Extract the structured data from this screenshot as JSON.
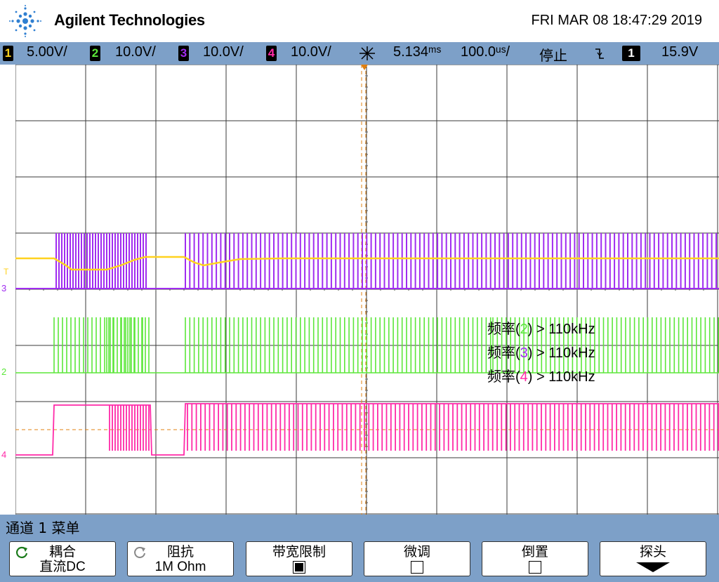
{
  "header": {
    "brand": "Agilent Technologies",
    "datetime": "FRI MAR 08 18:47:29 2019"
  },
  "status": {
    "ch1": {
      "num": "1",
      "scale": "5.00V/",
      "color": "#ffd21e"
    },
    "ch2": {
      "num": "2",
      "scale": "10.0V/",
      "color": "#5ce73a"
    },
    "ch3": {
      "num": "3",
      "scale": "10.0V/",
      "color": "#a02cf0"
    },
    "ch4": {
      "num": "4",
      "scale": "10.0V/",
      "color": "#ff2aa8"
    },
    "delay_icon": "trigger-delay-icon",
    "delay": "5.134ᵐˢ",
    "timebase": "100.0ᵘˢ/",
    "run_state": "停止",
    "trigger_edge": "falling-edge-icon",
    "trig_src": "1",
    "trig_level": "15.9V"
  },
  "screen": {
    "markers": {
      "t": "T",
      "ch1": "1",
      "ch2": "2",
      "ch3": "3",
      "ch4": "4"
    },
    "measurements": [
      {
        "label": "频率(",
        "ch": "2",
        "suffix": ") > 110kHz",
        "color": "#5ce73a"
      },
      {
        "label": "频率(",
        "ch": "3",
        "suffix": ") > 110kHz",
        "color": "#a02cf0"
      },
      {
        "label": "频率(",
        "ch": "4",
        "suffix": ") > 110kHz",
        "color": "#ff2aa8"
      }
    ]
  },
  "menu": {
    "title": "通道 1 菜单",
    "softkeys": [
      {
        "title": "耦合",
        "value": "直流DC",
        "icon": "rotate-icon"
      },
      {
        "title": "阻抗",
        "value": "1M Ohm",
        "icon": "rotate-icon"
      },
      {
        "title": "带宽限制",
        "checked": true
      },
      {
        "title": "微调",
        "checked": false
      },
      {
        "title": "倒置",
        "checked": false
      },
      {
        "title": "探头",
        "icon": "down-arrow-icon"
      }
    ]
  }
}
